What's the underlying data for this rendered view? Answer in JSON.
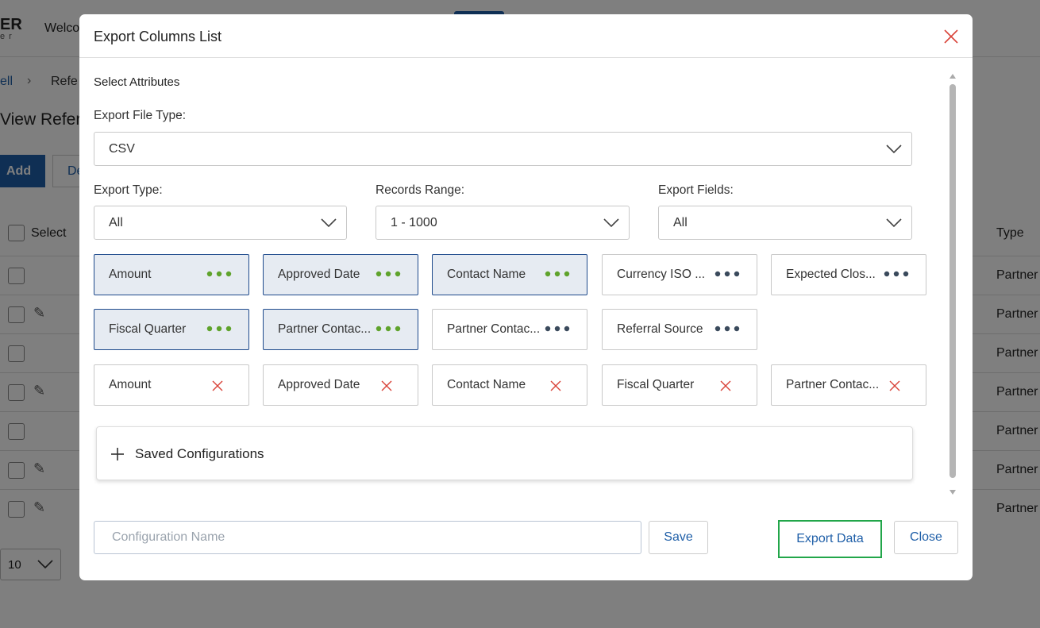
{
  "background": {
    "logo": "ER",
    "logo_sub": "er",
    "welcome": "Welco",
    "breadcrumb_first": "ell",
    "breadcrumb_sep": "›",
    "breadcrumb_second": "Refe",
    "page_title": "View Referra",
    "add_button": "Add",
    "de_button": "De",
    "select_header": "Select",
    "type_header": "Type",
    "rows": [
      {
        "type": "Partner",
        "edit": false
      },
      {
        "type": "Partner",
        "edit": true
      },
      {
        "type": "Partner",
        "edit": false
      },
      {
        "type": "Partner",
        "edit": true
      },
      {
        "type": "Partner",
        "edit": false
      },
      {
        "type": "Partner",
        "edit": true
      },
      {
        "type": "Partner",
        "edit": true
      }
    ],
    "page_size": "10"
  },
  "modal": {
    "title": "Export Columns List",
    "section_title": "Select Attributes",
    "file_type": {
      "label": "Export File Type:",
      "value": "CSV"
    },
    "export_type": {
      "label": "Export Type:",
      "value": "All"
    },
    "records_range": {
      "label": "Records Range:",
      "value": "1 - 1000"
    },
    "export_fields": {
      "label": "Export Fields:",
      "value": "All"
    },
    "attribute_chips": [
      {
        "label": "Amount",
        "selected": true
      },
      {
        "label": "Approved Date",
        "selected": true
      },
      {
        "label": "Contact Name",
        "selected": true
      },
      {
        "label": "Currency ISO ...",
        "selected": false
      },
      {
        "label": "Expected Clos...",
        "selected": false
      },
      {
        "label": "Fiscal Quarter",
        "selected": true
      },
      {
        "label": "Partner Contac...",
        "selected": true
      },
      {
        "label": "Partner Contac...",
        "selected": false
      },
      {
        "label": "Referral Source",
        "selected": false
      }
    ],
    "selected_chips": [
      {
        "label": "Amount"
      },
      {
        "label": "Approved Date"
      },
      {
        "label": "Contact Name"
      },
      {
        "label": "Fiscal Quarter"
      },
      {
        "label": "Partner Contac..."
      }
    ],
    "saved_configurations": "Saved Configurations",
    "config_name_placeholder": "Configuration Name",
    "save_button": "Save",
    "export_button": "Export Data",
    "close_button": "Close"
  },
  "colors": {
    "accent_blue": "#1f5fa8",
    "selected_dots": "#5fa32c",
    "unselected_dots": "#3a4a5c",
    "remove_x": "#d9443a",
    "focus_green": "#22a64a"
  },
  "icons": {
    "close": "close-icon",
    "chevron": "chevron-down-icon",
    "more": "more-dots-icon",
    "remove": "remove-x-icon",
    "plus": "plus-icon",
    "edit": "pencil-icon"
  }
}
